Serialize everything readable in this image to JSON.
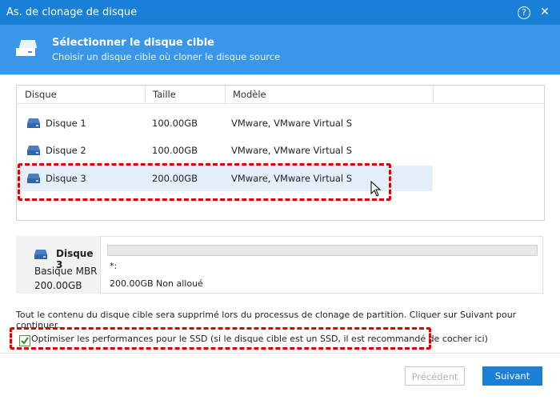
{
  "window": {
    "title": "As. de clonage de disque"
  },
  "header": {
    "title": "Sélectionner le disque cible",
    "subtitle": "Choisir un disque cible où cloner le disque source"
  },
  "table": {
    "columns": [
      "Disque",
      "Taille",
      "Modèle"
    ],
    "rows": [
      {
        "name": "Disque 1",
        "size": "100.00GB",
        "model": "VMware, VMware Virtual S"
      },
      {
        "name": "Disque 2",
        "size": "100.00GB",
        "model": "VMware, VMware Virtual S"
      },
      {
        "name": "Disque 3",
        "size": "200.00GB",
        "model": "VMware, VMware Virtual S"
      }
    ],
    "selected_index": 2
  },
  "details": {
    "title": "Disque 3",
    "type": "Basique MBR",
    "size": "200.00GB",
    "partition_label": "*:",
    "partition_desc": "200.00GB Non alloué"
  },
  "warning": "Tout le contenu du disque cible sera supprimé lors du processus de clonage de partition. Cliquer sur Suivant pour continuer.",
  "ssd_option": {
    "label": "Optimiser les performances pour le SSD (si le disque cible est un SSD, il est recommandé de cocher ici)",
    "checked": true
  },
  "footer": {
    "prev_label": "Précédent",
    "next_label": "Suivant"
  },
  "colors": {
    "titlebar": "#1a7fd6",
    "header": "#3a96e8",
    "highlight": "#e00000",
    "selected_row": "#e4effa"
  }
}
